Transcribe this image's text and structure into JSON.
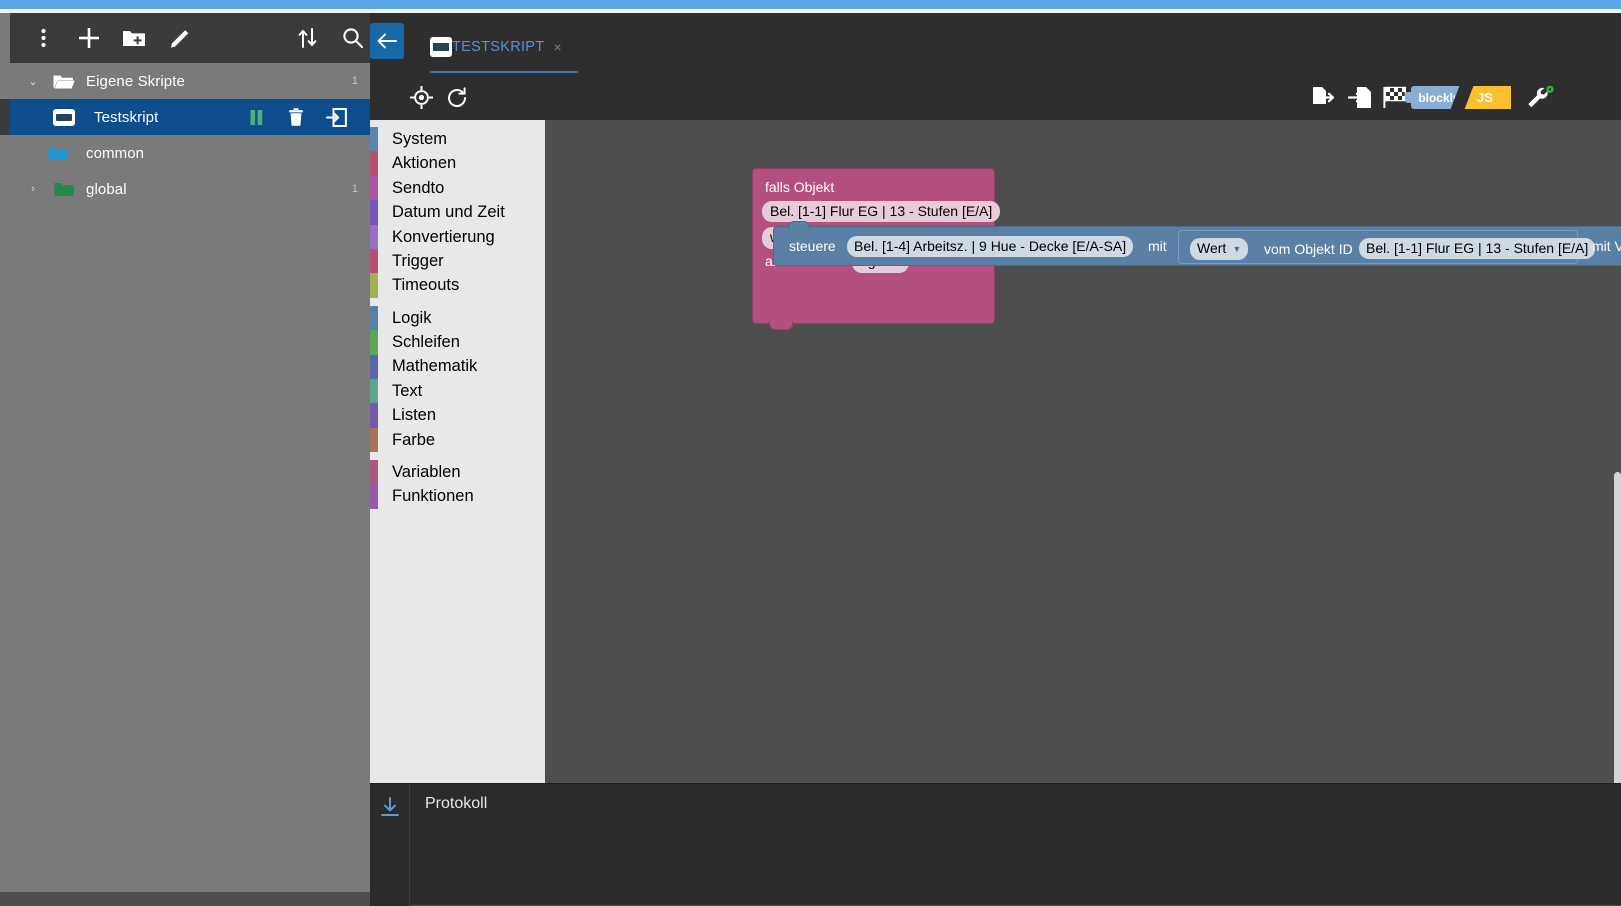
{
  "app": {
    "name": "ioBroker Javascript Adapter",
    "accent_blue": "#5aa7e8",
    "selection_blue": "#0f4e8e",
    "panel_gray": "#7a7a7a",
    "toolbar_dark": "#3b3b3b",
    "workspace_gray": "#4e4e4e",
    "toolbox_bg": "#e8e8e8"
  },
  "left_toolbar": {
    "buttons": [
      {
        "name": "more-menu",
        "icon": "dots-vertical-icon",
        "label": ""
      },
      {
        "name": "new-script",
        "icon": "plus-icon",
        "label": ""
      },
      {
        "name": "new-folder",
        "icon": "folder-plus-icon",
        "label": ""
      },
      {
        "name": "rename",
        "icon": "pencil-icon",
        "label": ""
      },
      {
        "name": "expand-collapse",
        "icon": "sort-arrows-icon",
        "label": ""
      },
      {
        "name": "search",
        "icon": "search-icon",
        "label": ""
      }
    ]
  },
  "tree": {
    "items": [
      {
        "label": "Eigene Skripte",
        "icon": "folder-open-icon",
        "count": "1",
        "level": 0,
        "expanded": true,
        "selected": false,
        "caret": "⌄"
      },
      {
        "label": "Testskript",
        "icon": "script-icon",
        "count": "",
        "level": 1,
        "expanded": false,
        "selected": true,
        "caret": ""
      },
      {
        "label": "common",
        "icon": "folder-icon",
        "count": "",
        "level": 1,
        "expanded": false,
        "selected": false,
        "caret": ""
      },
      {
        "label": "global",
        "icon": "folder-icon",
        "count": "1",
        "level": 1,
        "expanded": false,
        "selected": false,
        "caret": "›"
      }
    ],
    "row_actions": [
      {
        "name": "pause-script-button",
        "icon": "pause-icon"
      },
      {
        "name": "delete-script-button",
        "icon": "trash-icon"
      },
      {
        "name": "export-script-button",
        "icon": "arrow-into-box-icon"
      }
    ]
  },
  "tabs": {
    "back_button": {
      "name": "back-button",
      "icon": "arrow-left-icon"
    },
    "items": [
      {
        "label": "TESTSKRIPT",
        "icon": "script-icon",
        "close": "×",
        "active": true
      }
    ]
  },
  "editor_toolbar": {
    "left_buttons": [
      {
        "name": "locate-block-button",
        "icon": "crosshair-icon"
      },
      {
        "name": "reload-button",
        "icon": "refresh-icon"
      }
    ],
    "right_buttons": [
      {
        "name": "export-blocks-button",
        "icon": "export-icon"
      },
      {
        "name": "import-blocks-button",
        "icon": "import-icon"
      },
      {
        "name": "checkpoint-button",
        "icon": "checkered-flag-icon"
      },
      {
        "name": "settings-button",
        "icon": "wrench-icon"
      }
    ],
    "mode_toggle": {
      "left_label": "blockly",
      "right_label": "JS",
      "active": "blockly",
      "left_color": "#88aed4",
      "right_color": "#fcc02e"
    }
  },
  "toolbox": {
    "groups": [
      {
        "items": [
          {
            "label": "System",
            "color": "#5b85ad"
          },
          {
            "label": "Aktionen",
            "color": "#b5516e"
          },
          {
            "label": "Sendto",
            "color": "#a857a8"
          },
          {
            "label": "Datum und Zeit",
            "color": "#7755b5"
          },
          {
            "label": "Konvertierung",
            "color": "#9b6fc0"
          },
          {
            "label": "Trigger",
            "color": "#b5516e"
          },
          {
            "label": "Timeouts",
            "color": "#a3b254"
          }
        ]
      },
      {
        "items": [
          {
            "label": "Logik",
            "color": "#5b80a5"
          },
          {
            "label": "Schleifen",
            "color": "#5ba55b"
          },
          {
            "label": "Mathematik",
            "color": "#5b67a5"
          },
          {
            "label": "Text",
            "color": "#5ba58c"
          },
          {
            "label": "Listen",
            "color": "#745ba5"
          },
          {
            "label": "Farbe",
            "color": "#a5745b"
          }
        ]
      },
      {
        "items": [
          {
            "label": "Variablen",
            "color": "#a55b80"
          },
          {
            "label": "Funktionen",
            "color": "#995ba5"
          }
        ]
      }
    ]
  },
  "workspace": {
    "blocks": {
      "trigger": {
        "color": "#b3507f",
        "line1": "falls Objekt",
        "object_id": "Bel. [1-1] Flur EG | 13 - Stufen [E/A]",
        "condition": "wurde geändert",
        "ack_label": "anerkannt ist",
        "ack_value": "egal"
      },
      "control": {
        "color": "#5b80a5",
        "label": "steuere",
        "target_id": "Bel. [1-4] Arbeitsz. | 9 Hue - Decke [E/A-SA]",
        "with_label": "mit",
        "value_block": {
          "kind": "Wert",
          "from_label": "vom Objekt ID",
          "source_id": "Bel. [1-1] Flur EG | 13 - Stufen [E/A]"
        },
        "delay_label": "mit Verzögerung",
        "delay_checked": false
      }
    },
    "controls": [
      {
        "name": "center-workspace-button",
        "icon": "target-icon"
      },
      {
        "name": "zoom-in-button",
        "icon": "plus-circle-icon"
      },
      {
        "name": "zoom-out-button",
        "icon": "minus-circle-icon"
      },
      {
        "name": "workspace-trash",
        "icon": "trash-icon"
      }
    ]
  },
  "protokoll": {
    "title": "Protokoll",
    "download_icon": "download-icon",
    "lines": []
  }
}
